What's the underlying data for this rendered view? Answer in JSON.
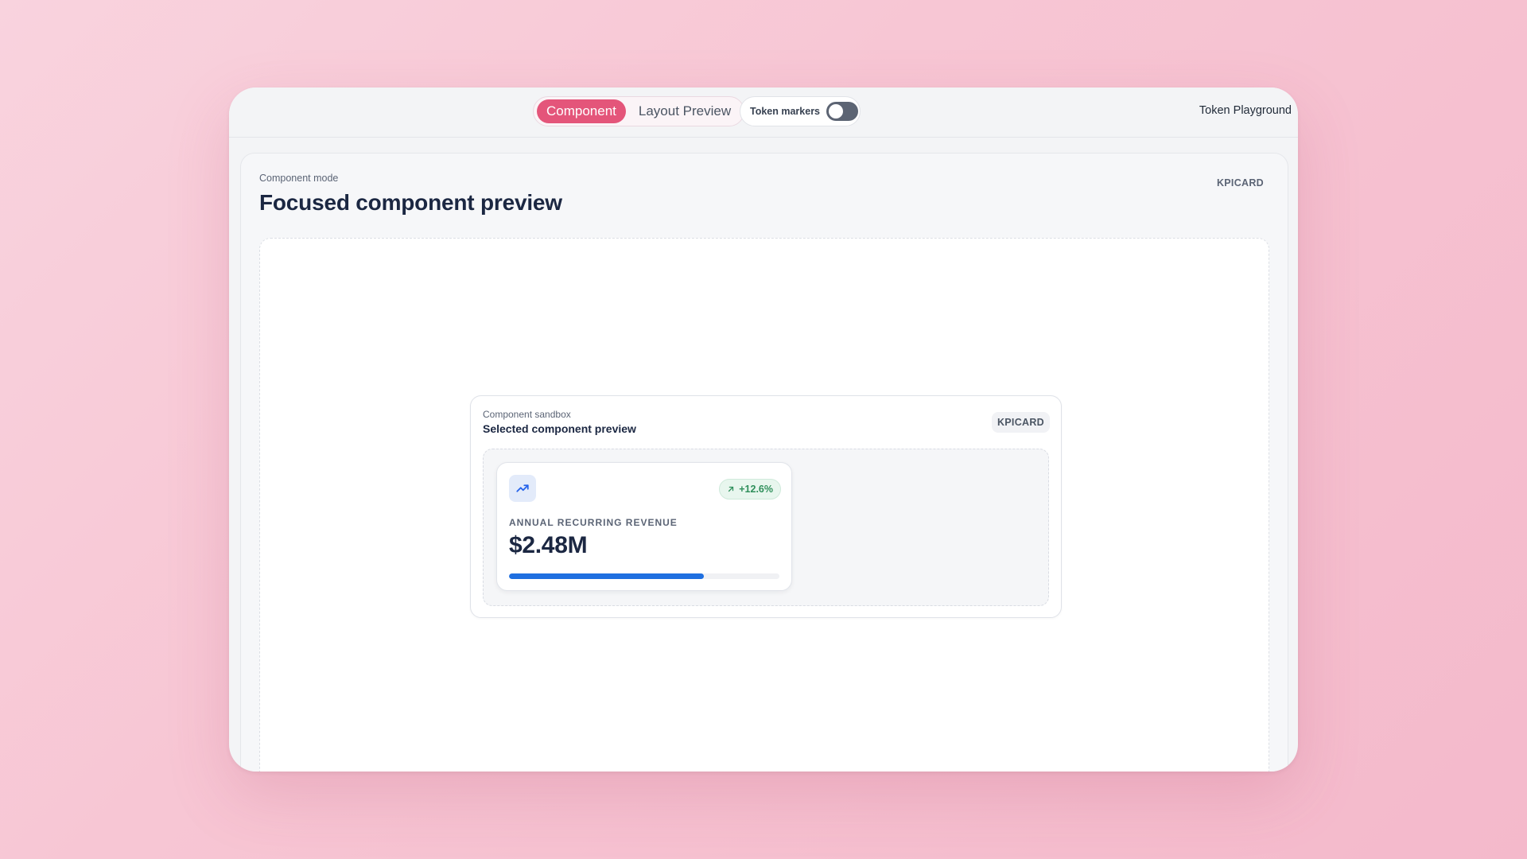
{
  "topbar": {
    "modes": [
      {
        "label": "Component",
        "active": true
      },
      {
        "label": "Layout Preview",
        "active": false
      }
    ],
    "token_markers": {
      "label": "Token markers",
      "enabled": false
    },
    "brand": "Token Playground"
  },
  "panel": {
    "mode_label": "Component mode",
    "title": "Focused component preview",
    "badge": "KPICARD"
  },
  "sandbox": {
    "label": "Component sandbox",
    "title": "Selected component preview",
    "badge": "KPICARD"
  },
  "kpi": {
    "icon": "trending-up-icon",
    "delta": "+12.6%",
    "delta_icon": "arrow-up-right-icon",
    "label": "ANNUAL RECURRING REVENUE",
    "value": "$2.48M",
    "progress_fraction": 0.72
  },
  "colors": {
    "accent": "#e4557a",
    "progress": "#1f6fe0",
    "positive": "#2f8f5b",
    "toggle_off": "#5c6473"
  }
}
